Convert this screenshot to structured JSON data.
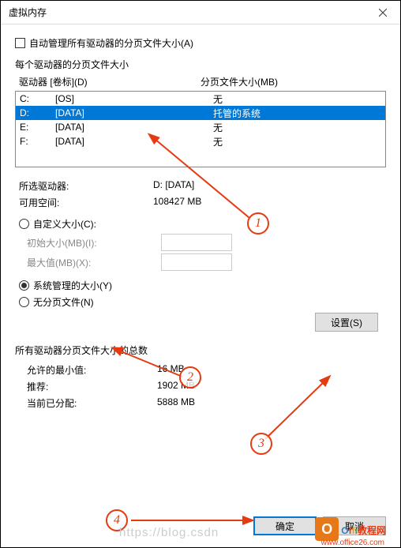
{
  "title": "虚拟内存",
  "auto_manage_label": "自动管理所有驱动器的分页文件大小(A)",
  "drives_section_label": "每个驱动器的分页文件大小",
  "list_header": {
    "col1": "驱动器 [卷标](D)",
    "col2": "分页文件大小(MB)"
  },
  "drives": [
    {
      "letter": "C:",
      "label": "[OS]",
      "size": "无"
    },
    {
      "letter": "D:",
      "label": "[DATA]",
      "size": "托管的系统"
    },
    {
      "letter": "E:",
      "label": "[DATA]",
      "size": "无"
    },
    {
      "letter": "F:",
      "label": "[DATA]",
      "size": "无"
    }
  ],
  "selected_drive": {
    "lbl": "所选驱动器:",
    "val": "D:  [DATA]"
  },
  "free_space": {
    "lbl": "可用空间:",
    "val": "108427 MB"
  },
  "radio_custom": "自定义大小(C):",
  "initial_size_lbl": "初始大小(MB)(I):",
  "max_size_lbl": "最大值(MB)(X):",
  "radio_system": "系统管理的大小(Y)",
  "radio_none": "无分页文件(N)",
  "set_btn": "设置(S)",
  "totals_label": "所有驱动器分页文件大小的总数",
  "min_allowed": {
    "lbl": "允许的最小值:",
    "val": "16 MB"
  },
  "recommended": {
    "lbl": "推荐:",
    "val": "1902 MB"
  },
  "allocated": {
    "lbl": "当前已分配:",
    "val": "5888 MB"
  },
  "ok_btn": "确定",
  "cancel_btn": "取消",
  "annotations": {
    "n1": "1",
    "n2": "2",
    "n3": "3",
    "n4": "4"
  },
  "watermark_text": "https://blog.csdn",
  "logo_url": "www.office26.com"
}
